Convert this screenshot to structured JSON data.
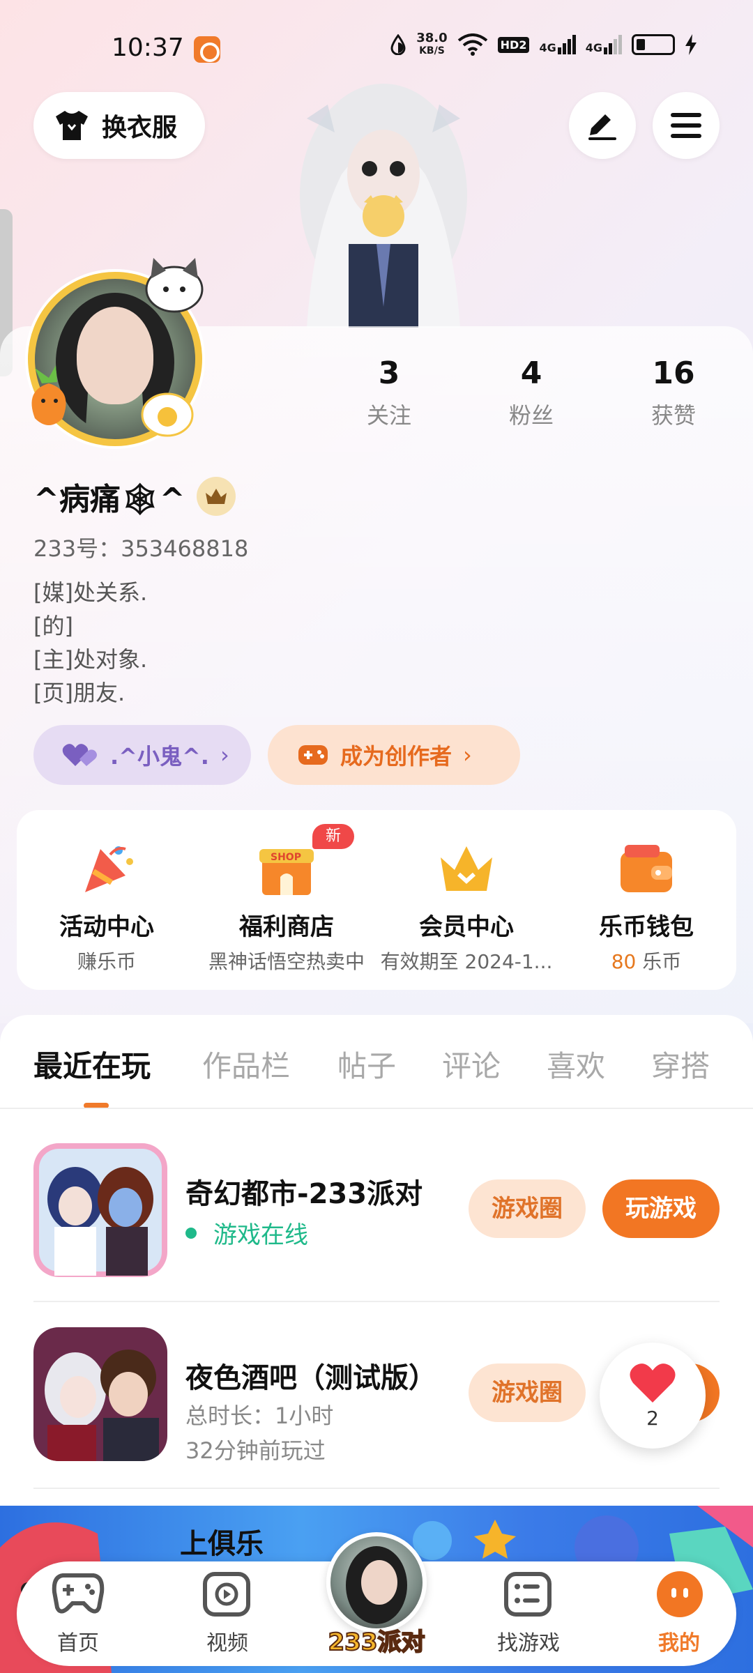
{
  "status": {
    "time": "10:37",
    "net_speed": "38.0",
    "net_unit": "KB/S",
    "hd": "HD2",
    "sim1": "4G",
    "sim2": "4G"
  },
  "top": {
    "outfit_label": "换衣服"
  },
  "profile": {
    "stats": [
      {
        "num": "3",
        "label": "关注"
      },
      {
        "num": "4",
        "label": "粉丝"
      },
      {
        "num": "16",
        "label": "获赞"
      }
    ],
    "username": "^病痛🕸^",
    "uid": "233号：353468818",
    "bio": [
      "[媒]处关系.",
      "[的]",
      "[主]处对象.",
      "[页]朋友."
    ],
    "friend_pill": ".^小鬼^.",
    "creator_pill": "成为创作者"
  },
  "features": [
    {
      "title": "活动中心",
      "sub": "赚乐币",
      "icon": "party-popper-icon"
    },
    {
      "title": "福利商店",
      "sub": "黑神话悟空热卖中",
      "icon": "shop-icon",
      "badge": "新"
    },
    {
      "title": "会员中心",
      "sub": "有效期至 2024-1...",
      "icon": "crown-icon"
    },
    {
      "title": "乐币钱包",
      "sub_coin": "80",
      "sub_unit": "乐币",
      "icon": "wallet-icon"
    }
  ],
  "shop_badge": "SHOP",
  "tabs": [
    "最近在玩",
    "作品栏",
    "帖子",
    "评论",
    "喜欢",
    "穿搭"
  ],
  "games": [
    {
      "title": "奇幻都市-233派对",
      "status": "游戏在线",
      "circle_btn": "游戏圈",
      "play_btn": "玩游戏"
    },
    {
      "title": "夜色酒吧（测试版）",
      "duration": "总时长：1小时",
      "last_played": "32分钟前玩过",
      "circle_btn": "游戏圈"
    }
  ],
  "next_game_partial": "上俱乐",
  "like_float": {
    "count": "2"
  },
  "bottom_nav": {
    "items": [
      "首页",
      "视频",
      "找游戏",
      "我的"
    ],
    "center_label": "233派对"
  },
  "colors": {
    "accent": "#f27623",
    "online": "#1fb98a",
    "friend": "#7a5fc0"
  }
}
